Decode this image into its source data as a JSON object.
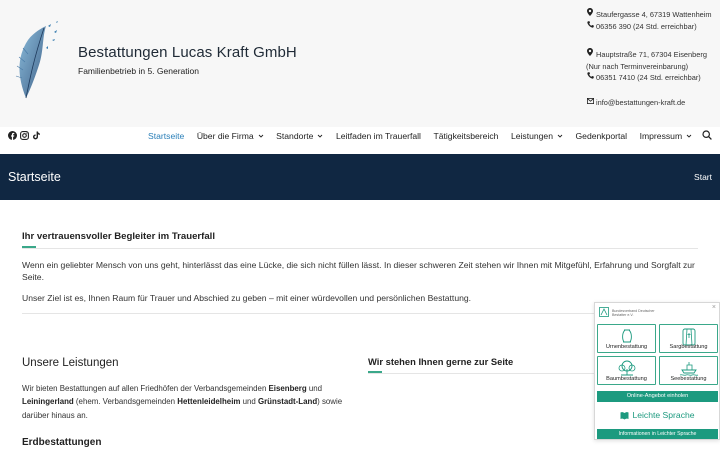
{
  "brand": {
    "name": "Bestattungen Lucas Kraft GmbH",
    "tagline": "Familienbetrieb in 5. Generation"
  },
  "contact": {
    "addr1": "Staufergasse 4, 67319 Wattenheim",
    "phone1": "06356 390 (24 Std. erreichbar)",
    "addr2": "Hauptstraße 71, 67304 Eisenberg",
    "addr2_note": "(Nur nach Terminvereinbarung)",
    "phone2": "06351 7410 (24 Std. erreichbar)",
    "email": "info@bestattungen-kraft.de"
  },
  "social": [
    "facebook-icon",
    "instagram-icon",
    "tiktok-icon"
  ],
  "nav": {
    "items": [
      {
        "label": "Startseite",
        "active": true,
        "dropdown": false
      },
      {
        "label": "Über die Firma",
        "active": false,
        "dropdown": true
      },
      {
        "label": "Standorte",
        "active": false,
        "dropdown": true
      },
      {
        "label": "Leitfaden im Trauerfall",
        "active": false,
        "dropdown": false
      },
      {
        "label": "Tätigkeitsbereich",
        "active": false,
        "dropdown": false
      },
      {
        "label": "Leistungen",
        "active": false,
        "dropdown": true
      },
      {
        "label": "Gedenkportal",
        "active": false,
        "dropdown": false
      },
      {
        "label": "Impressum",
        "active": false,
        "dropdown": true
      }
    ]
  },
  "page": {
    "title": "Startseite",
    "breadcrumb": "Start"
  },
  "intro": {
    "heading": "Ihr vertrauensvoller Begleiter im Trauerfall",
    "p1": "Wenn ein geliebter Mensch von uns geht, hinterlässt das eine Lücke, die sich nicht füllen lässt. In dieser schweren Zeit stehen wir Ihnen mit Mitgefühl, Erfahrung und Sorgfalt zur Seite.",
    "p2": "Unser Ziel ist es, Ihnen Raum für Trauer und Abschied zu geben – mit einer würdevollen und persönlichen Bestattung."
  },
  "leistungen": {
    "heading": "Unsere Leistungen",
    "t1": "Wir bieten Bestattungen auf allen Friedhöfen der Verbandsgemeinden ",
    "b1": "Eisenberg",
    "t2": " und ",
    "b2": "Leiningerland",
    "t3": " (ehem. Verbandsgemeinden ",
    "b3": "Hettenleidelheim",
    "t4": " und ",
    "b4": "Grünstadt-Land",
    "t5": ") sowie darüber hinaus an.",
    "sub": "Erdbestattungen"
  },
  "side": {
    "heading": "Wir stehen Ihnen gerne zur Seite"
  },
  "widget": {
    "logo_text": "Bundesverband Deutscher Bestatter e.V.",
    "close": "×",
    "cards": [
      {
        "label": "Urnenbestattung",
        "icon": "urn-icon"
      },
      {
        "label": "Sargbestattung",
        "icon": "coffin-icon"
      },
      {
        "label": "Baumbestattung",
        "icon": "tree-icon"
      },
      {
        "label": "Seebestattung",
        "icon": "ship-icon"
      }
    ],
    "offer_button": "Online-Angebot einholen",
    "easy_language": "Leichte Sprache",
    "info_button": "Informationen in Leichter Sprache"
  },
  "colors": {
    "navy": "#102742",
    "accent": "#3aa88a",
    "nav_active": "#2a7fb8",
    "widget_green": "#1c9a7f"
  }
}
